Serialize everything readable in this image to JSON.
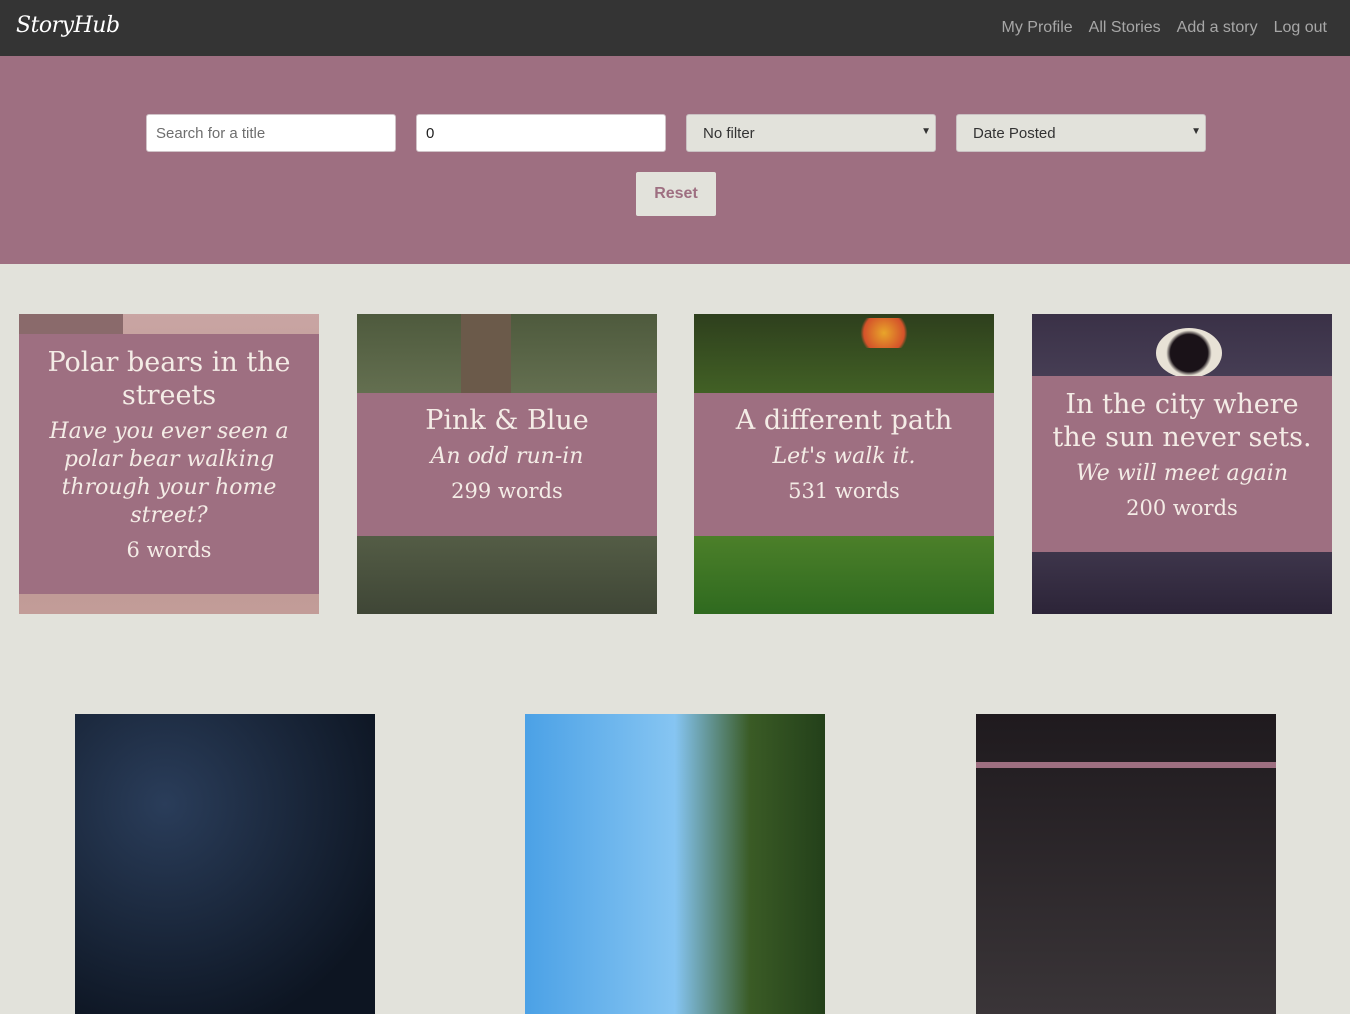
{
  "nav": {
    "logo": "StoryHub",
    "links": [
      "My Profile",
      "All Stories",
      "Add a story",
      "Log out"
    ]
  },
  "filters": {
    "search_placeholder": "Search for a title",
    "word_count_value": "0",
    "filter_select": "No filter",
    "sort_select": "Date Posted",
    "reset_label": "Reset"
  },
  "stories": [
    {
      "title": "Polar bears in the streets",
      "subtitle": "Have you ever seen a polar bear walking through your home street?",
      "words": "6 words"
    },
    {
      "title": "Pink & Blue",
      "subtitle": "An odd run-in",
      "words": "299 words"
    },
    {
      "title": "A different path",
      "subtitle": "Let's walk it.",
      "words": "531 words"
    },
    {
      "title": "In the city where the sun never sets.",
      "subtitle": "We will meet again",
      "words": "200 words"
    }
  ]
}
